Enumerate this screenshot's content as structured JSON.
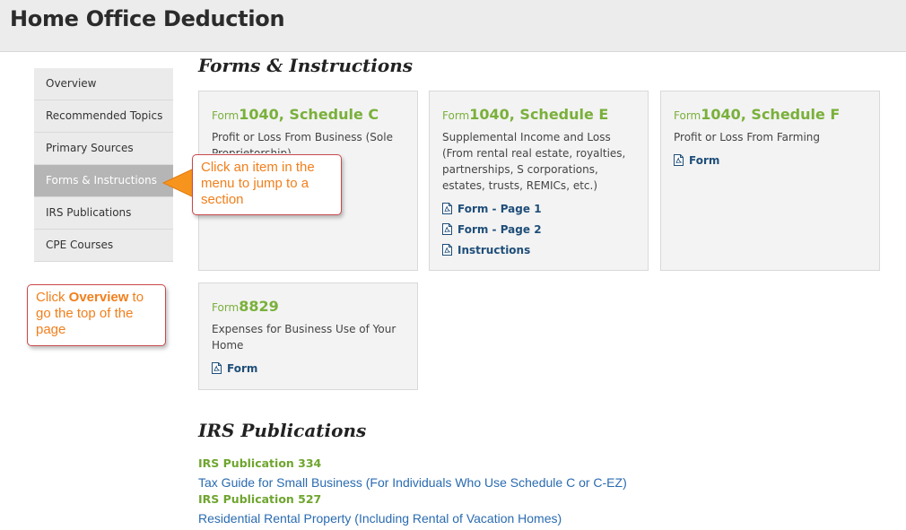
{
  "header": {
    "title": "Home Office Deduction"
  },
  "sidebar": {
    "items": [
      {
        "label": "Overview"
      },
      {
        "label": "Recommended Topics"
      },
      {
        "label": "Primary Sources"
      },
      {
        "label": "Forms & Instructions"
      },
      {
        "label": "IRS Publications"
      },
      {
        "label": "CPE Courses"
      }
    ],
    "active": "Forms & Instructions"
  },
  "forms_section": {
    "title": "Forms & Instructions",
    "cards": [
      {
        "prefix": "Form",
        "name": "1040, Schedule C",
        "description": "Profit or Loss From Business (Sole Proprietorship)",
        "links": []
      },
      {
        "prefix": "Form",
        "name": "1040, Schedule E",
        "description": "Supplemental Income and Loss (From rental real estate, royalties, partnerships, S corporations, estates, trusts, REMICs, etc.)",
        "links": [
          "Form - Page 1",
          "Form - Page 2",
          "Instructions"
        ]
      },
      {
        "prefix": "Form",
        "name": "1040, Schedule F",
        "description": "Profit or Loss From Farming",
        "links": [
          "Form"
        ]
      },
      {
        "prefix": "Form",
        "name": "8829",
        "description": "Expenses for Business Use of Your Home",
        "links": [
          "Form"
        ]
      }
    ]
  },
  "callouts": {
    "menu_tip": "Click an item in the menu to jump to a section",
    "overview_tip": {
      "before": "Click ",
      "bold": "Overview",
      "after": " to go the top of the page"
    }
  },
  "publications_section": {
    "title": "IRS Publications",
    "items": [
      {
        "title": "IRS Publication 334",
        "description": "Tax Guide for Small Business (For Individuals Who Use Schedule C or C-EZ)"
      },
      {
        "title": "IRS Publication 527",
        "description": "Residential Rental Property (Including Rental of Vacation Homes)"
      }
    ]
  },
  "colors": {
    "accent_green": "#7ab03b",
    "link_blue": "#1f4e79",
    "callout_orange": "#f27f1b",
    "callout_border": "#c9484a"
  },
  "icons": {
    "pdf": "pdf-file-icon"
  }
}
